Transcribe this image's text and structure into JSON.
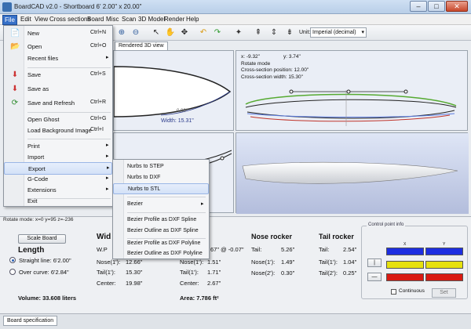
{
  "titlebar": {
    "title": "BoardCAD v2.0 - Shortboard  6' 2.00\" x 20.00\""
  },
  "window_buttons": {
    "minimize": "–",
    "maximize": "□",
    "close": "✕"
  },
  "menubar": [
    "File",
    "Edit",
    "View",
    "Cross sections",
    "Board",
    "Misc",
    "Scan",
    "3D Model",
    "Render",
    "Help"
  ],
  "toolbar": {
    "unit_label": "Unit:",
    "unit_value": "Imperial (decimal)"
  },
  "tab_3d": "Rendered 3D view",
  "view_top_right": {
    "lines": [
      "x:  -9.32\"",
      "y:  3.74\"",
      "Rotate mode",
      "Cross-section position:  12.00\"",
      "Cross-section width:  15.30\""
    ]
  },
  "view_partial_label": "Width: 15.31\"",
  "view_partial_label2": "0.00\"",
  "file_menu": [
    {
      "label": "New",
      "shortcut": "Ctrl+N",
      "icon": "new-icon"
    },
    {
      "label": "Open",
      "shortcut": "Ctrl+O",
      "icon": "open-icon"
    },
    {
      "label": "Recent files",
      "shortcut": "",
      "icon": "",
      "sub": true
    },
    {
      "label": "Save",
      "shortcut": "Ctrl+S",
      "icon": "save-icon"
    },
    {
      "label": "Save as",
      "shortcut": "",
      "icon": "save-as-icon"
    },
    {
      "label": "Save and Refresh",
      "shortcut": "Ctrl+R",
      "icon": "save-refresh-icon"
    },
    {
      "label": "Open Ghost",
      "shortcut": "Ctrl+G",
      "icon": ""
    },
    {
      "label": "Load Background Image",
      "shortcut": "Ctrl+I",
      "icon": ""
    },
    {
      "label": "Print",
      "shortcut": "",
      "icon": "",
      "sub": true
    },
    {
      "label": "Import",
      "shortcut": "",
      "icon": "",
      "sub": true
    },
    {
      "label": "Export",
      "shortcut": "",
      "icon": "",
      "sub": true
    },
    {
      "label": "G-Code",
      "shortcut": "",
      "icon": "",
      "sub": true
    },
    {
      "label": "Extensions",
      "shortcut": "",
      "icon": "",
      "sub": true
    },
    {
      "label": "Exit",
      "shortcut": "",
      "icon": ""
    }
  ],
  "export_submenu": [
    {
      "label": "Nurbs to STEP"
    },
    {
      "label": "Nurbs to DXF"
    },
    {
      "label": "Nurbs to STL"
    },
    {
      "label": "Bezier",
      "sub": true
    },
    {
      "label": "Bezier Profile as DXF Spline"
    },
    {
      "label": "Bezier Outline as DXF Spline"
    },
    {
      "label": "Bezier Profile as DXF Polyline"
    },
    {
      "label": "Bezier Outline as DXF Polyline"
    }
  ],
  "status": {
    "rotate_line": "Rotate mode: x=0 y=95 z=-236"
  },
  "specs": {
    "scale_button": "Scale Board",
    "length_title": "Length",
    "straight_line": "Straight line: 6'2.00\"",
    "over_curve": "Over curve: 6'2.84\"",
    "volume": "Volume: 33.608 liters",
    "width_title": "Wid",
    "wp": "W.P",
    "nose1": "Nose(1'):",
    "nose1_val": "12.66\"",
    "tail1": "Tail(1'):",
    "tail1_val": "15.30\"",
    "center": "Center:",
    "center_val": "19.98\"",
    "thick_wp": "67\" @ -0.07\"",
    "thick_nose": "Nose(1'):",
    "thick_nose_val": "1.51\"",
    "thick_tail": "Tail(1'):",
    "thick_tail_val": "1.71\"",
    "thick_center": "Center:",
    "thick_center_val": "2.67\"",
    "area": "Area: 7.786 ft²",
    "nose_rocker_title": "Nose rocker",
    "nr_tail": "Tail:",
    "nr_tail_val": "5.26\"",
    "nr_1": "Nose(1'):",
    "nr_1_val": "1.49\"",
    "nr_2": "Nose(2'):",
    "nr_2_val": "0.30\"",
    "tail_rocker_title": "Tail rocker",
    "tr_tail": "Tail:",
    "tr_tail_val": "2.54\"",
    "tr_1": "Tail(1'):",
    "tr_1_val": "1.04\"",
    "tr_2": "Tail(2'):",
    "tr_2_val": "0.25\""
  },
  "control_point": {
    "title": "Control point info",
    "x_label": "X",
    "y_label": "Y",
    "continuous": "Continuous",
    "set": "Set",
    "btn_bar": "|",
    "btn_dash": "—",
    "colors": {
      "blue": "#1d2ee0",
      "yellow": "#e6e10e",
      "red": "#d91a12"
    }
  },
  "bottom_tab": "Board specification"
}
